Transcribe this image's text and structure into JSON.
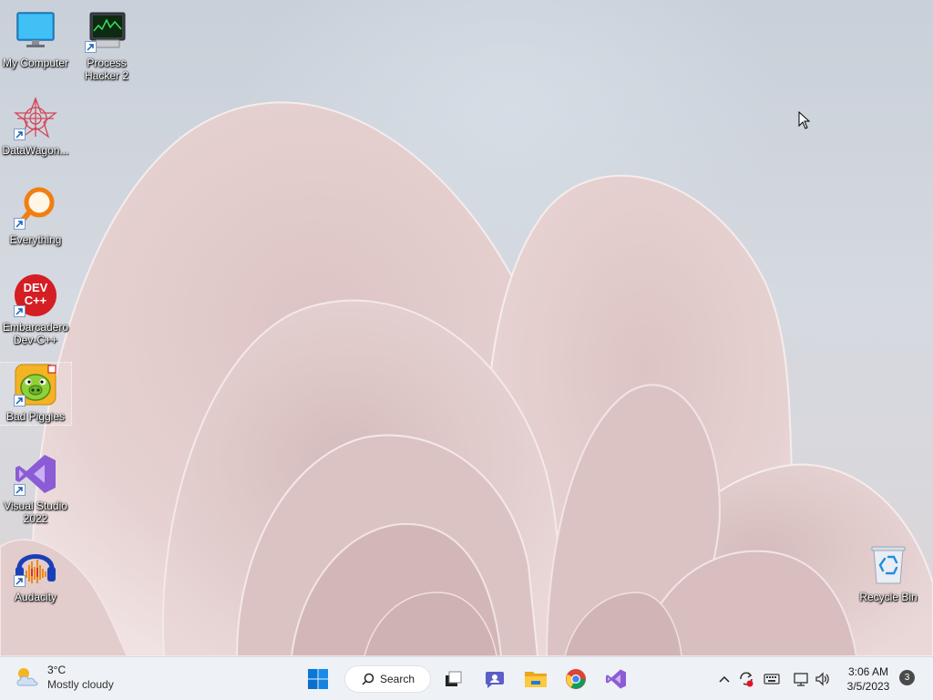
{
  "desktop": {
    "icons": [
      {
        "label": "My Computer",
        "icon": "monitor-icon"
      },
      {
        "label": "Process Hacker 2",
        "icon": "process-hacker-icon"
      },
      {
        "label": "DataWagon...",
        "icon": "datawagon-icon"
      },
      {
        "label": "Everything",
        "icon": "magnifier-icon"
      },
      {
        "label": "Embarcadero Dev-C++",
        "icon": "devcpp-icon"
      },
      {
        "label": "Bad Piggies",
        "icon": "bad-piggies-icon"
      },
      {
        "label": "Visual Studio 2022",
        "icon": "visual-studio-icon"
      },
      {
        "label": "Audacity",
        "icon": "audacity-icon"
      },
      {
        "label": "Recycle Bin",
        "icon": "recycle-bin-icon"
      }
    ],
    "devcpp_logo_text": "DEV C++"
  },
  "taskbar": {
    "weather": {
      "temp": "3°C",
      "condition": "Mostly cloudy"
    },
    "search_label": "Search",
    "pinned": [
      "start-icon",
      "task-view-icon",
      "chat-icon",
      "file-explorer-icon",
      "chrome-icon",
      "visual-studio-icon"
    ],
    "tray": [
      "chevron-up-icon",
      "sync-icon",
      "keyboard-icon",
      "network-icon",
      "volume-icon"
    ],
    "clock": {
      "time": "3:06 AM",
      "date": "3/5/2023"
    },
    "notification_count": "3"
  },
  "colors": {
    "taskbar_bg": "#eef1f6",
    "wallpaper_petal": "#e6cfcf",
    "accent": "#0078d4"
  }
}
